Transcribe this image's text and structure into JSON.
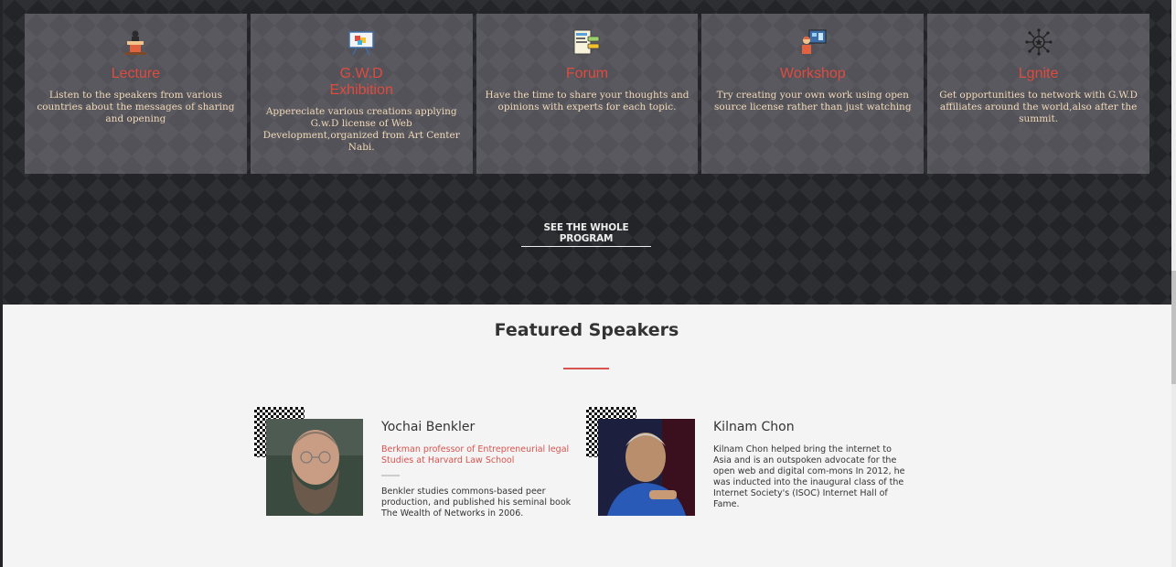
{
  "programs": [
    {
      "title": "Lecture",
      "description": "Listen to the speakers from various countries about the messages of sharing and opening",
      "icon": "lecture-podium-icon"
    },
    {
      "title": "G.W.D Exhibition",
      "description": "Appereciate various creations applying G.w.D license of Web Development,organized from Art Center Nabi.",
      "icon": "exhibition-easel-icon"
    },
    {
      "title": "Forum",
      "description": "Have the time to share your thoughts and opinions with experts for each topic.",
      "icon": "forum-board-icon"
    },
    {
      "title": "Workshop",
      "description": "Try creating your own work using open source license rather than just watching",
      "icon": "workshop-presenter-icon"
    },
    {
      "title": "Lgnite",
      "description": "Get opportunities to network with G.W.D affiliates around the world,also after the summit.",
      "icon": "network-hub-icon"
    }
  ],
  "see_program": "SEE THE WHOLE PROGRAM",
  "featured": {
    "title": "Featured Speakers"
  },
  "speakers": [
    {
      "name": "Yochai Benkler",
      "role": "Berkman professor of Entrepreneurial legal Studies at Harvard Law School",
      "bio": "Benkler studies commons-based peer production, and published his seminal book The Wealth of Networks in 2006."
    },
    {
      "name": "Kilnam Chon",
      "role": "",
      "bio": "Kilnam Chon helped bring the internet to Asia and is an outspoken advocate for the open web and digital com-mons In 2012, he was inducted into the inaugural class of the Internet Society's (ISOC) Internet Hall of Fame."
    }
  ],
  "colors": {
    "accent": "#d9534f",
    "program_title": "#e04b3f",
    "program_desc": "#f3d9b8",
    "dark_bg": "#232428",
    "card_bg": "#525258"
  }
}
